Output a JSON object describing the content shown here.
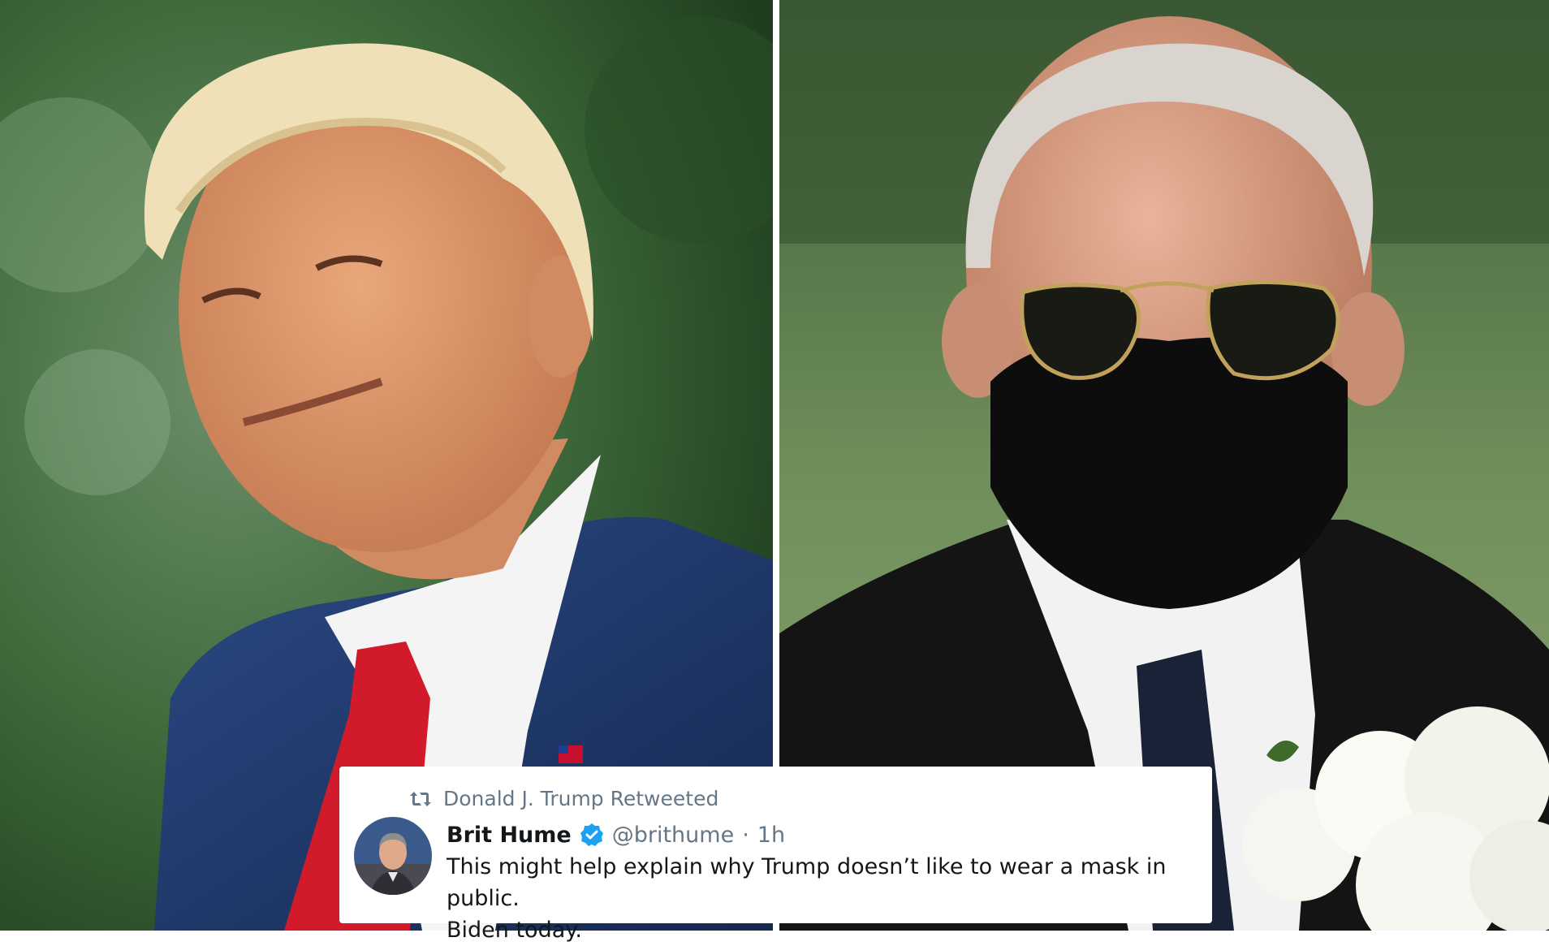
{
  "tweet": {
    "retweet_label": "Donald J. Trump Retweeted",
    "author_name": "Brit Hume",
    "handle": "@brithume",
    "separator": "·",
    "time": "1h",
    "text": "This might help explain why Trump doesn’t like to wear a mask in public.\nBiden today.",
    "icons": {
      "retweet": "retweet-icon",
      "verified": "verified-badge-icon",
      "avatar": "avatar"
    }
  },
  "colors": {
    "verified_blue": "#1da1f2",
    "meta_gray": "#657786",
    "text_dark": "#14171a"
  }
}
